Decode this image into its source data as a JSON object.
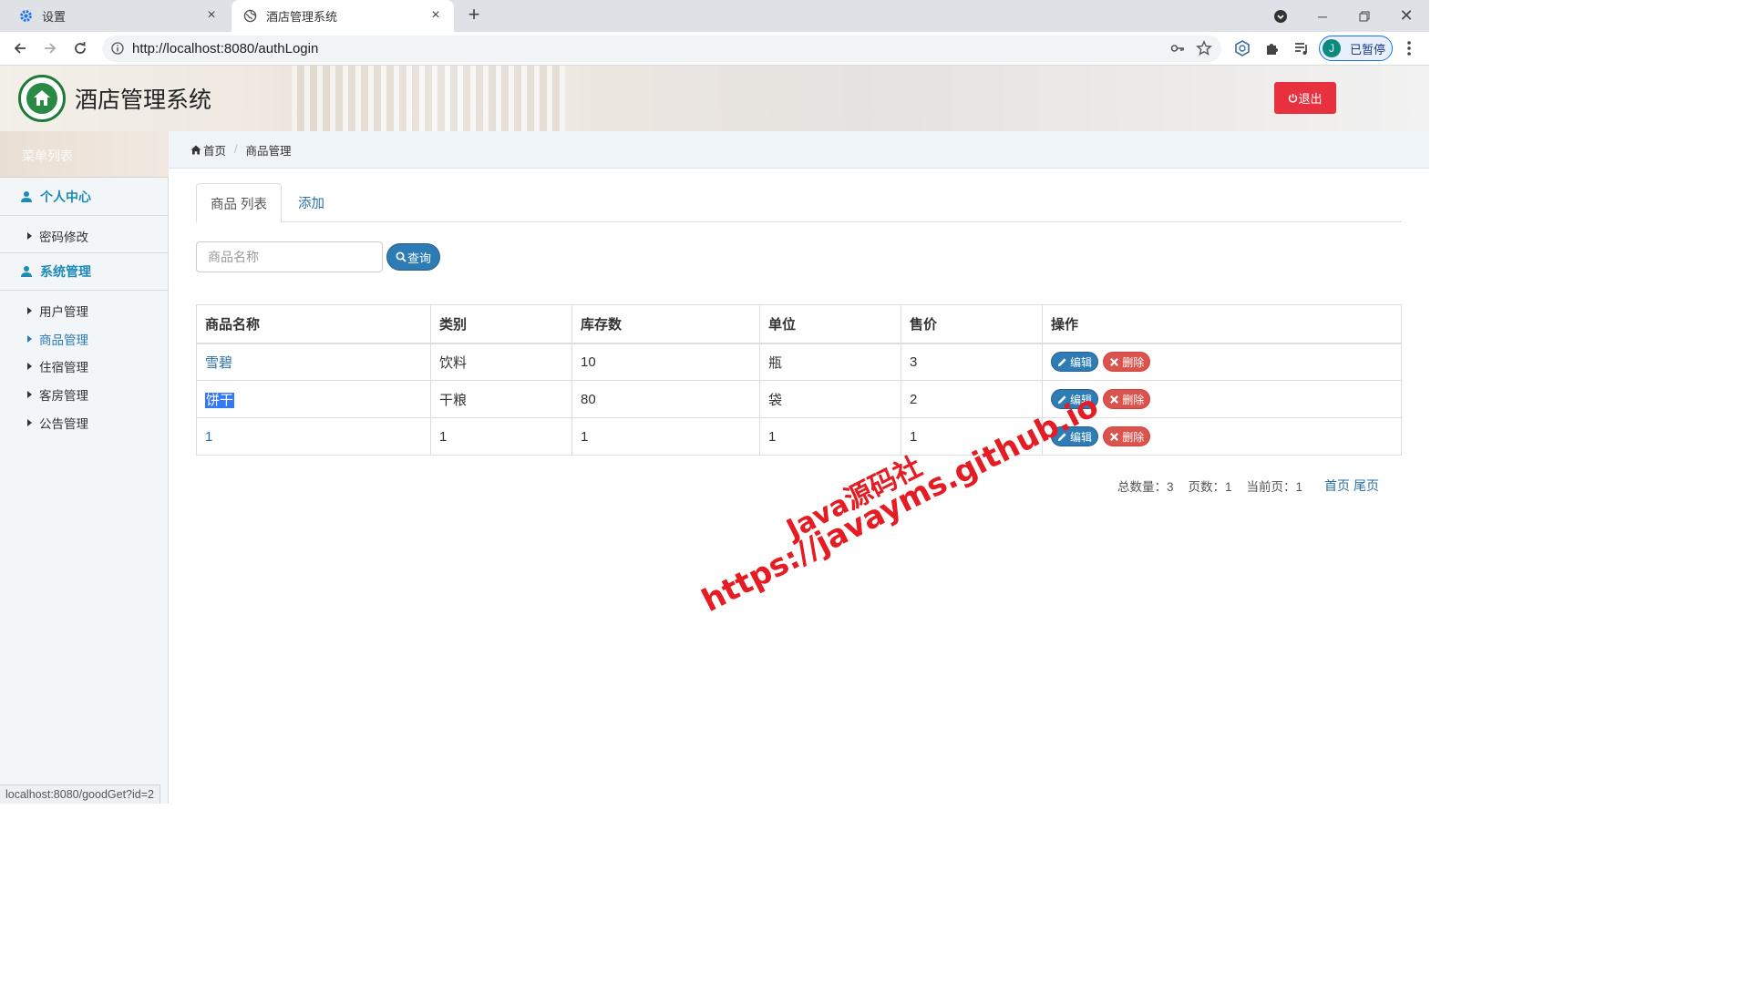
{
  "browser": {
    "tabs": [
      {
        "title": "设置",
        "icon": "gear-icon",
        "active": false
      },
      {
        "title": "酒店管理系统",
        "icon": "globe-icon",
        "active": true
      }
    ],
    "url": "http://localhost:8080/authLogin",
    "profile_initial": "J",
    "profile_status": "已暂停",
    "status_url": "localhost:8080/goodGet?id=2"
  },
  "header": {
    "app_title": "酒店管理系统",
    "logout_label": "退出"
  },
  "sidebar": {
    "menu_label": "菜单列表",
    "sections": [
      {
        "label": "个人中心",
        "items": [
          "密码修改"
        ]
      },
      {
        "label": "系统管理",
        "items": [
          "用户管理",
          "商品管理",
          "住宿管理",
          "客房管理",
          "公告管理"
        ]
      }
    ],
    "active_item": "商品管理"
  },
  "breadcrumb": {
    "home": "首页",
    "current": "商品管理"
  },
  "tabs": {
    "list": "商品 列表",
    "add": "添加"
  },
  "search": {
    "placeholder": "商品名称",
    "button": "查询"
  },
  "table": {
    "headers": [
      "商品名称",
      "类别",
      "库存数",
      "单位",
      "售价",
      "操作"
    ],
    "rows": [
      [
        "雪碧",
        "饮料",
        "10",
        "瓶",
        "3"
      ],
      [
        "饼干",
        "干粮",
        "80",
        "袋",
        "2"
      ],
      [
        "1",
        "1",
        "1",
        "1",
        "1"
      ]
    ],
    "edit_label": "编辑",
    "delete_label": "删除"
  },
  "pager": {
    "total": "总数量：3",
    "pages": "页数：1",
    "current": "当前页：1",
    "first": "首页",
    "last": "尾页"
  },
  "watermark": {
    "line1": "Java源码社",
    "line2": "https://javayms.github.io"
  },
  "colors": {
    "primary": "#2e7cb5",
    "danger": "#d9534f",
    "logout": "#e8313f",
    "sidebar_accent": "#1d8ab8"
  }
}
